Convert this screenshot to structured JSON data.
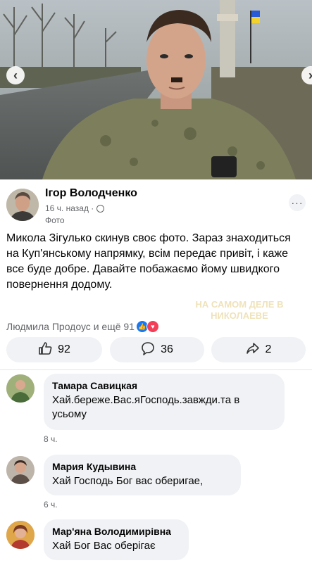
{
  "photo": {
    "subject": "soldier-selfie-photo",
    "nav": {
      "prev": "‹",
      "next": "›"
    }
  },
  "post": {
    "author": "Ігор Володченко",
    "time": "16 ч. назад ·",
    "photo_tag": "Фото",
    "more": "···",
    "text": "Микола Зігулько скинув своє фото. Зараз знаходиться на Куп'янському напрямку, всім передає привіт, і каже все буде добре. Давайте побажаємо йому швидкого повернення додому.",
    "watermark_line1": "НА САМОМ ДЕЛЕ В",
    "watermark_line2": "НИКОЛАЕВЕ",
    "reactions_text": "Людмила Продоус и ещё 91",
    "reaction_icons": [
      "like-icon",
      "love-icon"
    ]
  },
  "actions": {
    "like_count": "92",
    "comment_count": "36",
    "share_count": "2"
  },
  "comments": [
    {
      "author": "Тамара Савицкая",
      "text": "Хай.береже.Вас.яГосподь.завжди.та в усьому",
      "time": "8 ч."
    },
    {
      "author": "Мария Кудывина",
      "text": "Хай Господь Бог вас оберигае,",
      "time": "6 ч."
    },
    {
      "author": "Мар'яна Володимирівна",
      "text": "Хай Бог Вас оберігає",
      "time": ""
    }
  ],
  "colors": {
    "accent": "#1877f2",
    "love": "#f33e58",
    "bubble": "#f0f2f5",
    "muted_text": "#65676b"
  }
}
